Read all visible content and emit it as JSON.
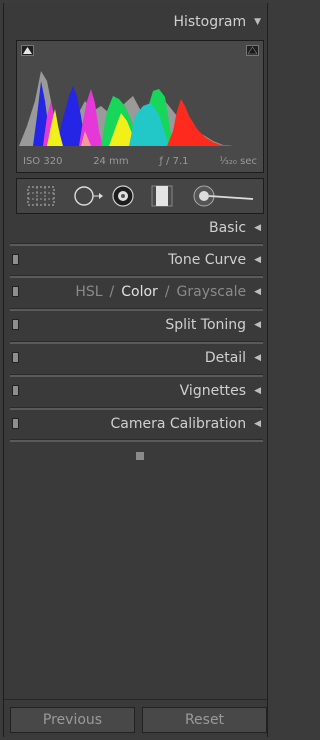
{
  "histogram": {
    "title": "Histogram",
    "iso": "ISO 320",
    "focal_length": "24 mm",
    "aperture": "ƒ / 7.1",
    "shutter": "¹⁄₃₂₀ sec"
  },
  "tools": [
    "crop-tool",
    "spot-removal-tool",
    "red-eye-tool",
    "graduated-filter-tool",
    "adjustment-brush-tool"
  ],
  "panels": {
    "basic": "Basic",
    "tone_curve": "Tone Curve",
    "hsl": "HSL",
    "slash1": "/",
    "color": "Color",
    "slash2": "/",
    "grayscale": "Grayscale",
    "split_toning": "Split Toning",
    "detail": "Detail",
    "vignettes": "Vignettes",
    "camera_calibration": "Camera Calibration"
  },
  "footer": {
    "previous_label": "Previous",
    "reset_label": "Reset"
  },
  "colors": {
    "red": "#ff2a1e",
    "green": "#17d65a",
    "blue": "#2525e6",
    "yellow": "#f2f01a",
    "magenta": "#e638d8",
    "cyan": "#22c8c8"
  }
}
